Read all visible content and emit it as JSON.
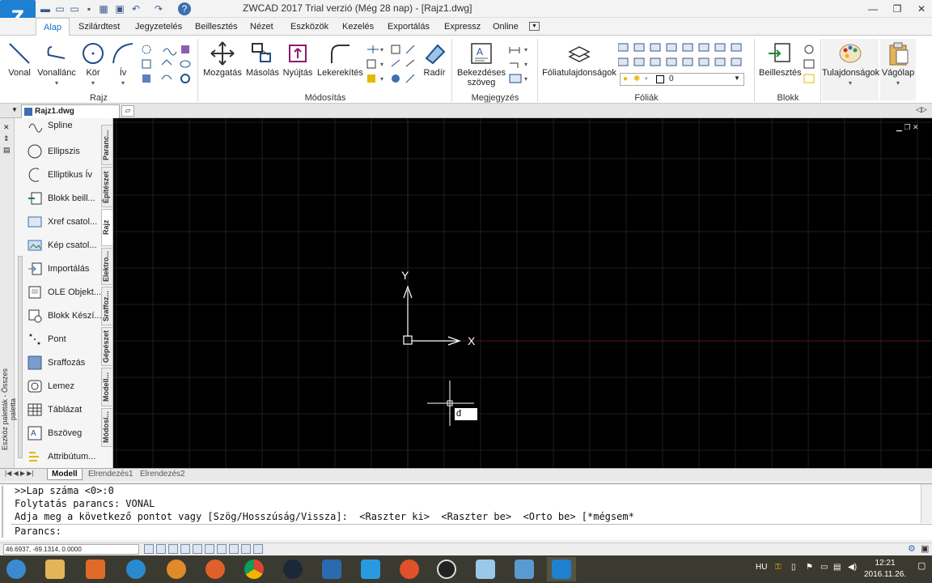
{
  "window": {
    "title": "ZWCAD 2017 Trial verzió  (Még 28 nap) - [Rajz1.dwg]",
    "logo_text": "Z"
  },
  "ribbon_tabs": [
    "Alap",
    "Szilárdtest",
    "Jegyzetelés",
    "Beillesztés",
    "Nézet",
    "Eszközök",
    "Kezelés",
    "Exportálás",
    "Expressz",
    "Online"
  ],
  "ribbon": {
    "rajz": {
      "group": "Rajz",
      "vonal": "Vonal",
      "vonallanc": "Vonallánc",
      "kor": "Kör",
      "iv": "Ív"
    },
    "modositas": {
      "group": "Módosítás",
      "mozgatas": "Mozgatás",
      "masolas": "Másolás",
      "nyujtas": "Nyújtás",
      "lekerekites": "Lekerekítés",
      "radir": "Radír"
    },
    "megjegyzes": {
      "group": "Megjegyzés",
      "bekezdeses_line1": "Bekezdéses",
      "bekezdeses_line2": "szöveg"
    },
    "foliak": {
      "group": "Fóliák",
      "foliatulajdonsagok": "Fóliatulajdonságok",
      "layer_value": "0"
    },
    "blokk": {
      "group": "Blokk",
      "beillesztes": "Beillesztés"
    },
    "tulajdonsagok": "Tulajdonságok",
    "vagolap": "Vágólap"
  },
  "document_tab": "Rajz1.dwg",
  "palette": {
    "title": "Eszköz paletták - Összes paletta",
    "items": [
      "Spline",
      "Ellipszis",
      "Elliptikus Ív",
      "Blokk beill...",
      "Xref csatol...",
      "Kép csatol...",
      "Importálás",
      "OLE Objekt...",
      "Blokk Készí...",
      "Pont",
      "Sraffozás",
      "Lemez",
      "Táblázat",
      "Bszöveg",
      "Attribútum..."
    ],
    "tabs": [
      "Paranc...",
      "Építészet",
      "Rajz",
      "Elektro...",
      "Sraffoz...",
      "Gépészet",
      "Modell...",
      "Módosí..."
    ]
  },
  "canvas": {
    "ucs_y": "Y",
    "ucs_x": "X",
    "dynamic_input": "đ"
  },
  "layout_tabs": [
    "Modell",
    "Elrendezés1",
    "Elrendezés2"
  ],
  "command": {
    "history": [
      ">>Lap száma <0>:0",
      "Folytatás parancs: VONAL",
      "Adja meg a következő pontot vagy [Szög/Hosszúság/Vissza]:  <Raszter ki>  <Raszter be>  <Orto be> [*mégsem*"
    ],
    "prompt": "Parancs:"
  },
  "status": {
    "coords": "46.6937, -69.1314, 0.0000"
  },
  "taskbar": {
    "language": "HU",
    "time": "12:21",
    "date": "2016.11.26."
  },
  "colors": {
    "accent": "#1a6fcf",
    "canvas_bg": "#000000",
    "taskbar_bg": "#3b3a30"
  }
}
